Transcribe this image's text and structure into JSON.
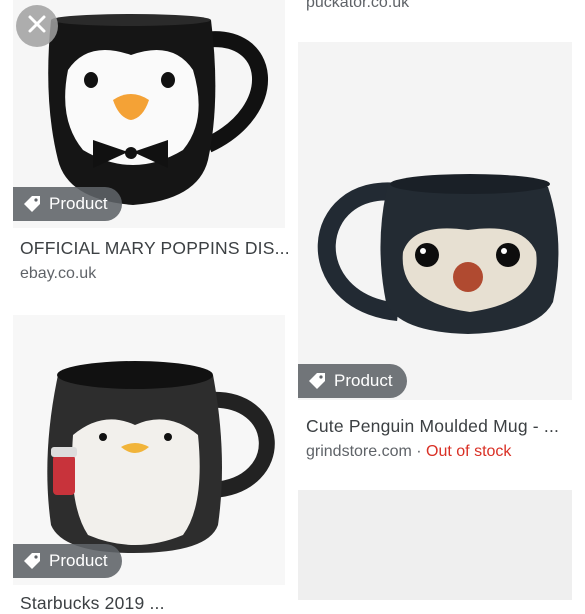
{
  "top_source": "puckator.co.uk",
  "results": [
    {
      "badge": "Product",
      "title": "OFFICIAL MARY POPPINS DIS...",
      "source": "ebay.co.uk"
    },
    {
      "badge": "Product",
      "title": "Cute Penguin Moulded Mug - ...",
      "source": "grindstore.com",
      "separator": " · ",
      "status": "Out of stock"
    },
    {
      "badge": "Product",
      "title": "Starbucks 2019 ...",
      "source": ""
    }
  ],
  "icons": {
    "close": "close-icon",
    "tag": "tag-icon"
  },
  "colors": {
    "badge_bg": "#5f6368",
    "out_of_stock": "#d93025"
  }
}
